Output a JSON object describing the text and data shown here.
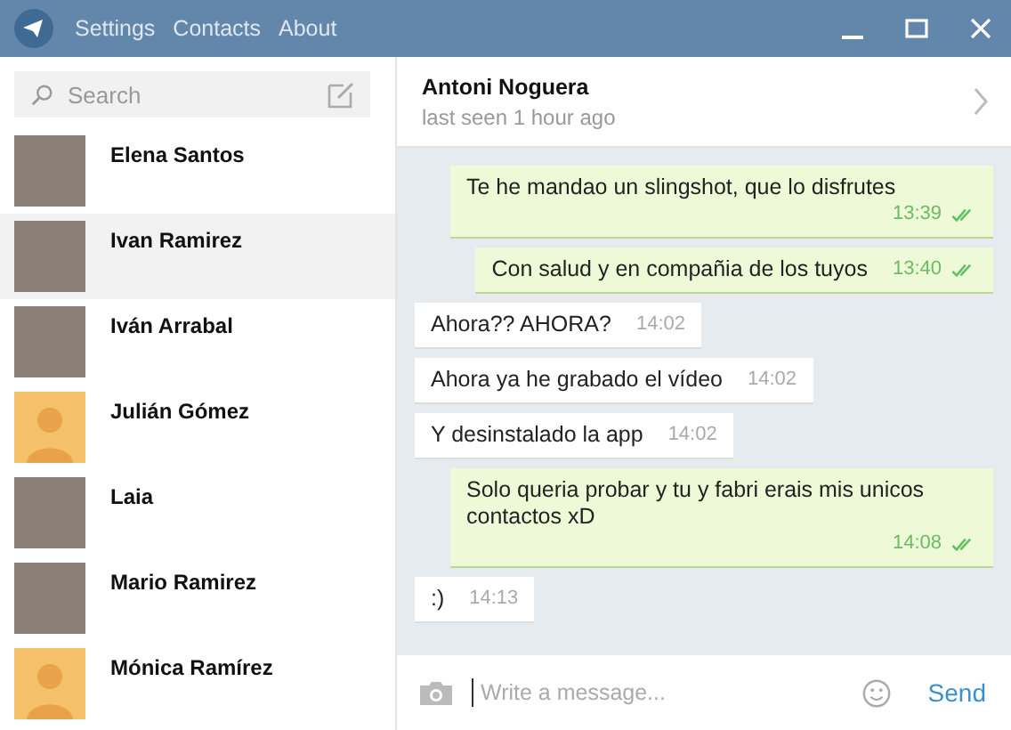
{
  "menu": [
    "Settings",
    "Contacts",
    "About"
  ],
  "search": {
    "placeholder": "Search"
  },
  "contacts": [
    {
      "name": "Elena Santos",
      "kind": "photo",
      "selected": false
    },
    {
      "name": "Ivan Ramirez",
      "kind": "photo",
      "selected": true
    },
    {
      "name": "Iván Arrabal",
      "kind": "photo",
      "selected": false
    },
    {
      "name": "Julián Gómez",
      "kind": "silhouette",
      "selected": false
    },
    {
      "name": "Laia",
      "kind": "photo",
      "selected": false
    },
    {
      "name": "Mario Ramirez",
      "kind": "photo",
      "selected": false
    },
    {
      "name": "Mónica Ramírez",
      "kind": "silhouette",
      "selected": false
    }
  ],
  "chat": {
    "name": "Antoni Noguera",
    "status": "last seen 1 hour ago"
  },
  "messages": [
    {
      "text": "Te he mandao un slingshot, que lo disfrutes",
      "time": "13:39",
      "outgoing": true,
      "read": true
    },
    {
      "text": "Con salud y en compañia de los tuyos",
      "time": "13:40",
      "outgoing": true,
      "read": true
    },
    {
      "text": "Ahora?? AHORA?",
      "time": "14:02",
      "outgoing": false,
      "read": false
    },
    {
      "text": "Ahora ya he grabado el vídeo",
      "time": "14:02",
      "outgoing": false,
      "read": false
    },
    {
      "text": "Y desinstalado la app",
      "time": "14:02",
      "outgoing": false,
      "read": false
    },
    {
      "text": "Solo queria probar y tu y fabri erais mis unicos contactos xD",
      "time": "14:08",
      "outgoing": true,
      "read": true
    },
    {
      "text": ":)",
      "time": "14:13",
      "outgoing": false,
      "read": false
    }
  ],
  "composer": {
    "placeholder": "Write a message...",
    "send": "Send"
  }
}
